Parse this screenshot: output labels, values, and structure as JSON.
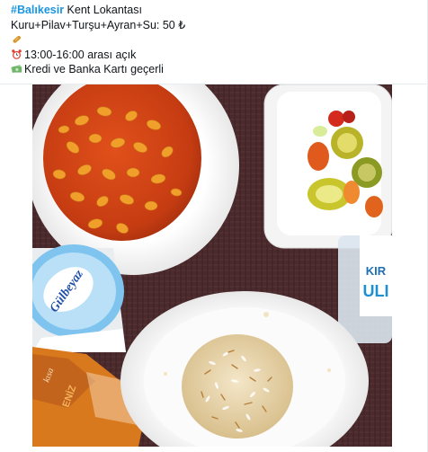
{
  "post": {
    "hashtag": "#Balıkesir",
    "title_rest": " Kent Lokantası",
    "menu_line": "Kuru+Pilav+Turşu+Ayran+Su: 50 ₺",
    "hours_line": "13:00-16:00 arası açık",
    "payment_line": "Kredi ve Banka Kartı geçerli",
    "icons": [
      "bread-icon",
      "alarm-clock-icon",
      "money-icon"
    ]
  },
  "photo": {
    "cup_brand": "Gülbeyaz",
    "bottle_text_top": "KIR",
    "bottle_text_bottom": "ULI",
    "bag_text": "ENİZ",
    "bag_text2": "kısa"
  }
}
